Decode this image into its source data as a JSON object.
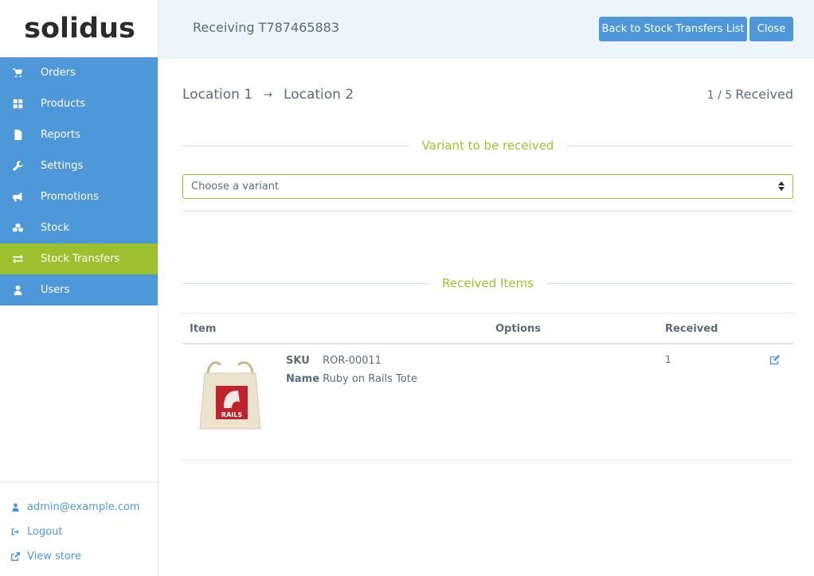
{
  "brand": {
    "logo_text": "solidus"
  },
  "sidebar": {
    "items": [
      {
        "label": "Orders",
        "icon": "cart-icon"
      },
      {
        "label": "Products",
        "icon": "grid-icon"
      },
      {
        "label": "Reports",
        "icon": "file-icon"
      },
      {
        "label": "Settings",
        "icon": "wrench-icon"
      },
      {
        "label": "Promotions",
        "icon": "bullhorn-icon"
      },
      {
        "label": "Stock",
        "icon": "cubes-icon"
      },
      {
        "label": "Stock Transfers",
        "icon": "exchange-icon",
        "active": true
      },
      {
        "label": "Users",
        "icon": "user-icon"
      }
    ],
    "footer": {
      "email": "admin@example.com",
      "logout": "Logout",
      "view_store": "View store"
    }
  },
  "header": {
    "title": "Receiving T787465883",
    "back_label": "Back to Stock Transfers List",
    "close_label": "Close"
  },
  "transfer": {
    "from": "Location 1",
    "arrow": "→",
    "to": "Location 2",
    "received_count": "1 / 5",
    "received_label": "Received"
  },
  "variant_section": {
    "title": "Variant to be received",
    "select_placeholder": "Choose a variant"
  },
  "received_section": {
    "title": "Received Items",
    "columns": [
      "Item",
      "Options",
      "Received"
    ],
    "rows": [
      {
        "sku_label": "SKU",
        "sku": "ROR-00011",
        "name_label": "Name",
        "name": "Ruby on Rails Tote",
        "image_text": "RAILS",
        "received": "1"
      }
    ]
  },
  "colors": {
    "primary": "#4e97d9",
    "accent": "#9dc12e",
    "header_bg": "#edf5fc",
    "text": "#5a6b7d"
  }
}
